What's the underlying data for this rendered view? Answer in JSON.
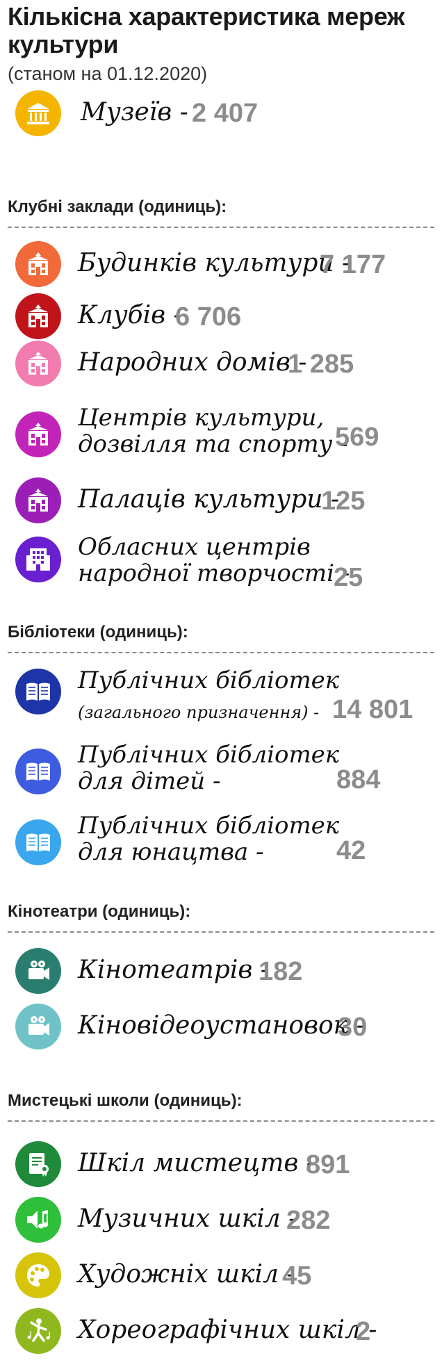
{
  "header": {
    "title": "Кількісна характеристика мереж культури",
    "subtitle": "(станом на 01.12.2020)"
  },
  "museums": {
    "label": "Музеїв -",
    "value": "2 407",
    "icon": "museum-icon",
    "color": "#f5b400"
  },
  "clubs": {
    "heading": "Клубні заклади (одиниць):",
    "items": [
      {
        "label": "Будинків культури -",
        "value": "7 177",
        "icon": "building-icon",
        "color": "#f26a3a"
      },
      {
        "label": "Клубів -",
        "value": "6 706",
        "icon": "building-icon",
        "color": "#c0141a"
      },
      {
        "label": "Народних домів -",
        "value": "1 285",
        "icon": "building-icon",
        "color": "#f27bb0"
      },
      {
        "label_line1": "Центрів культури,",
        "label_line2": "дозвілля та спорту -",
        "value": "569",
        "icon": "building-icon",
        "color": "#c324b8"
      },
      {
        "label": "Палаців культури -",
        "value": "125",
        "icon": "building-icon",
        "color": "#9b1fb7"
      },
      {
        "label_line1": "Обласних центрів",
        "label_line2": "народної творчості -",
        "value": "25",
        "icon": "office-building-icon",
        "color": "#6a1fd0"
      }
    ]
  },
  "libraries": {
    "heading": "Бібліотеки (одиниць):",
    "items": [
      {
        "label_line1": "Публічних бібліотек",
        "label_line2": "(загального призначення) -",
        "value": "14 801",
        "icon": "book-icon",
        "color": "#1e35a8"
      },
      {
        "label_line1": "Публічних бібліотек",
        "label_line2": "для дітей -",
        "value": "884",
        "icon": "book-icon",
        "color": "#3d5ce0"
      },
      {
        "label_line1": "Публічних бібліотек",
        "label_line2": "для юнацтва -",
        "value": "42",
        "icon": "book-icon",
        "color": "#3aa6ee"
      }
    ]
  },
  "cinemas": {
    "heading": "Кінотеатри (одиниць):",
    "items": [
      {
        "label": "Кінотеатрів -",
        "value": "182",
        "icon": "movie-camera-icon",
        "color": "#2a7e70"
      },
      {
        "label": "Кіновідеоустановок -",
        "value": "30",
        "icon": "movie-camera-icon",
        "color": "#6fc2c8"
      }
    ]
  },
  "art_schools": {
    "heading": "Мистецькі школи (одиниць):",
    "items": [
      {
        "label": "Шкіл мистецтв -",
        "value": "891",
        "icon": "certificate-icon",
        "color": "#1e8a3a"
      },
      {
        "label": "Музичних шкіл -",
        "value": "282",
        "icon": "music-speaker-icon",
        "color": "#2fbf3a"
      },
      {
        "label": "Художніх шкіл -",
        "value": "45",
        "icon": "palette-icon",
        "color": "#d6c40a"
      },
      {
        "label": "Хореографічних шкіл -",
        "value": "2",
        "icon": "dancer-icon",
        "color": "#8fb81e"
      }
    ]
  }
}
